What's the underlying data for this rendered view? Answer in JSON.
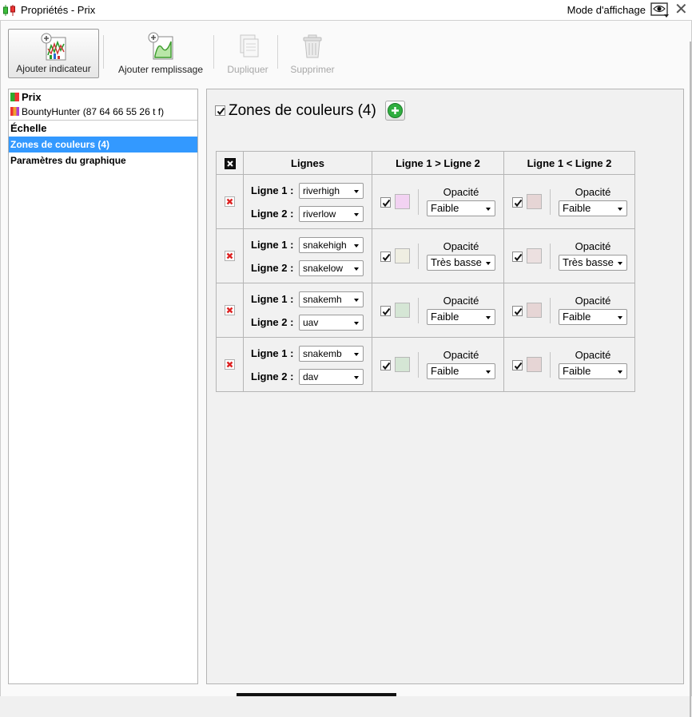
{
  "window": {
    "title": "Propriétés - Prix",
    "view_mode_label": "Mode d'affichage"
  },
  "toolbar": {
    "add_indicator": "Ajouter indicateur",
    "add_fill": "Ajouter remplissage",
    "duplicate": "Dupliquer",
    "delete": "Supprimer"
  },
  "tree": {
    "items": [
      {
        "label": "Prix"
      },
      {
        "label": "BountyHunter (87 64 66 55 26 t f)"
      },
      {
        "label": "Échelle"
      },
      {
        "label": "Zones de couleurs (4)"
      },
      {
        "label": "Paramètres du graphique"
      }
    ]
  },
  "zones": {
    "title": "Zones de couleurs (4)",
    "headers": {
      "lines": "Lignes",
      "above": "Ligne 1 > Ligne 2",
      "below": "Ligne 1 < Ligne 2"
    },
    "line1_label": "Ligne 1 :",
    "line2_label": "Ligne 2 :",
    "opacity_label": "Opacité",
    "rows": [
      {
        "line1": "riverhigh",
        "line2": "riverlow",
        "above_color": "#f2d2f2",
        "above_opacity": "Faible",
        "below_color": "#e6d5d5",
        "below_opacity": "Faible"
      },
      {
        "line1": "snakehigh",
        "line2": "snakelow",
        "above_color": "#efeee2",
        "above_opacity": "Très basse",
        "below_color": "#ece0e0",
        "below_opacity": "Très basse"
      },
      {
        "line1": "snakemh",
        "line2": "uav",
        "above_color": "#d5e6d5",
        "above_opacity": "Faible",
        "below_color": "#e6d5d5",
        "below_opacity": "Faible"
      },
      {
        "line1": "snakemb",
        "line2": "dav",
        "above_color": "#d5e6d5",
        "above_opacity": "Faible",
        "below_color": "#e6d5d5",
        "below_opacity": "Faible"
      }
    ]
  }
}
